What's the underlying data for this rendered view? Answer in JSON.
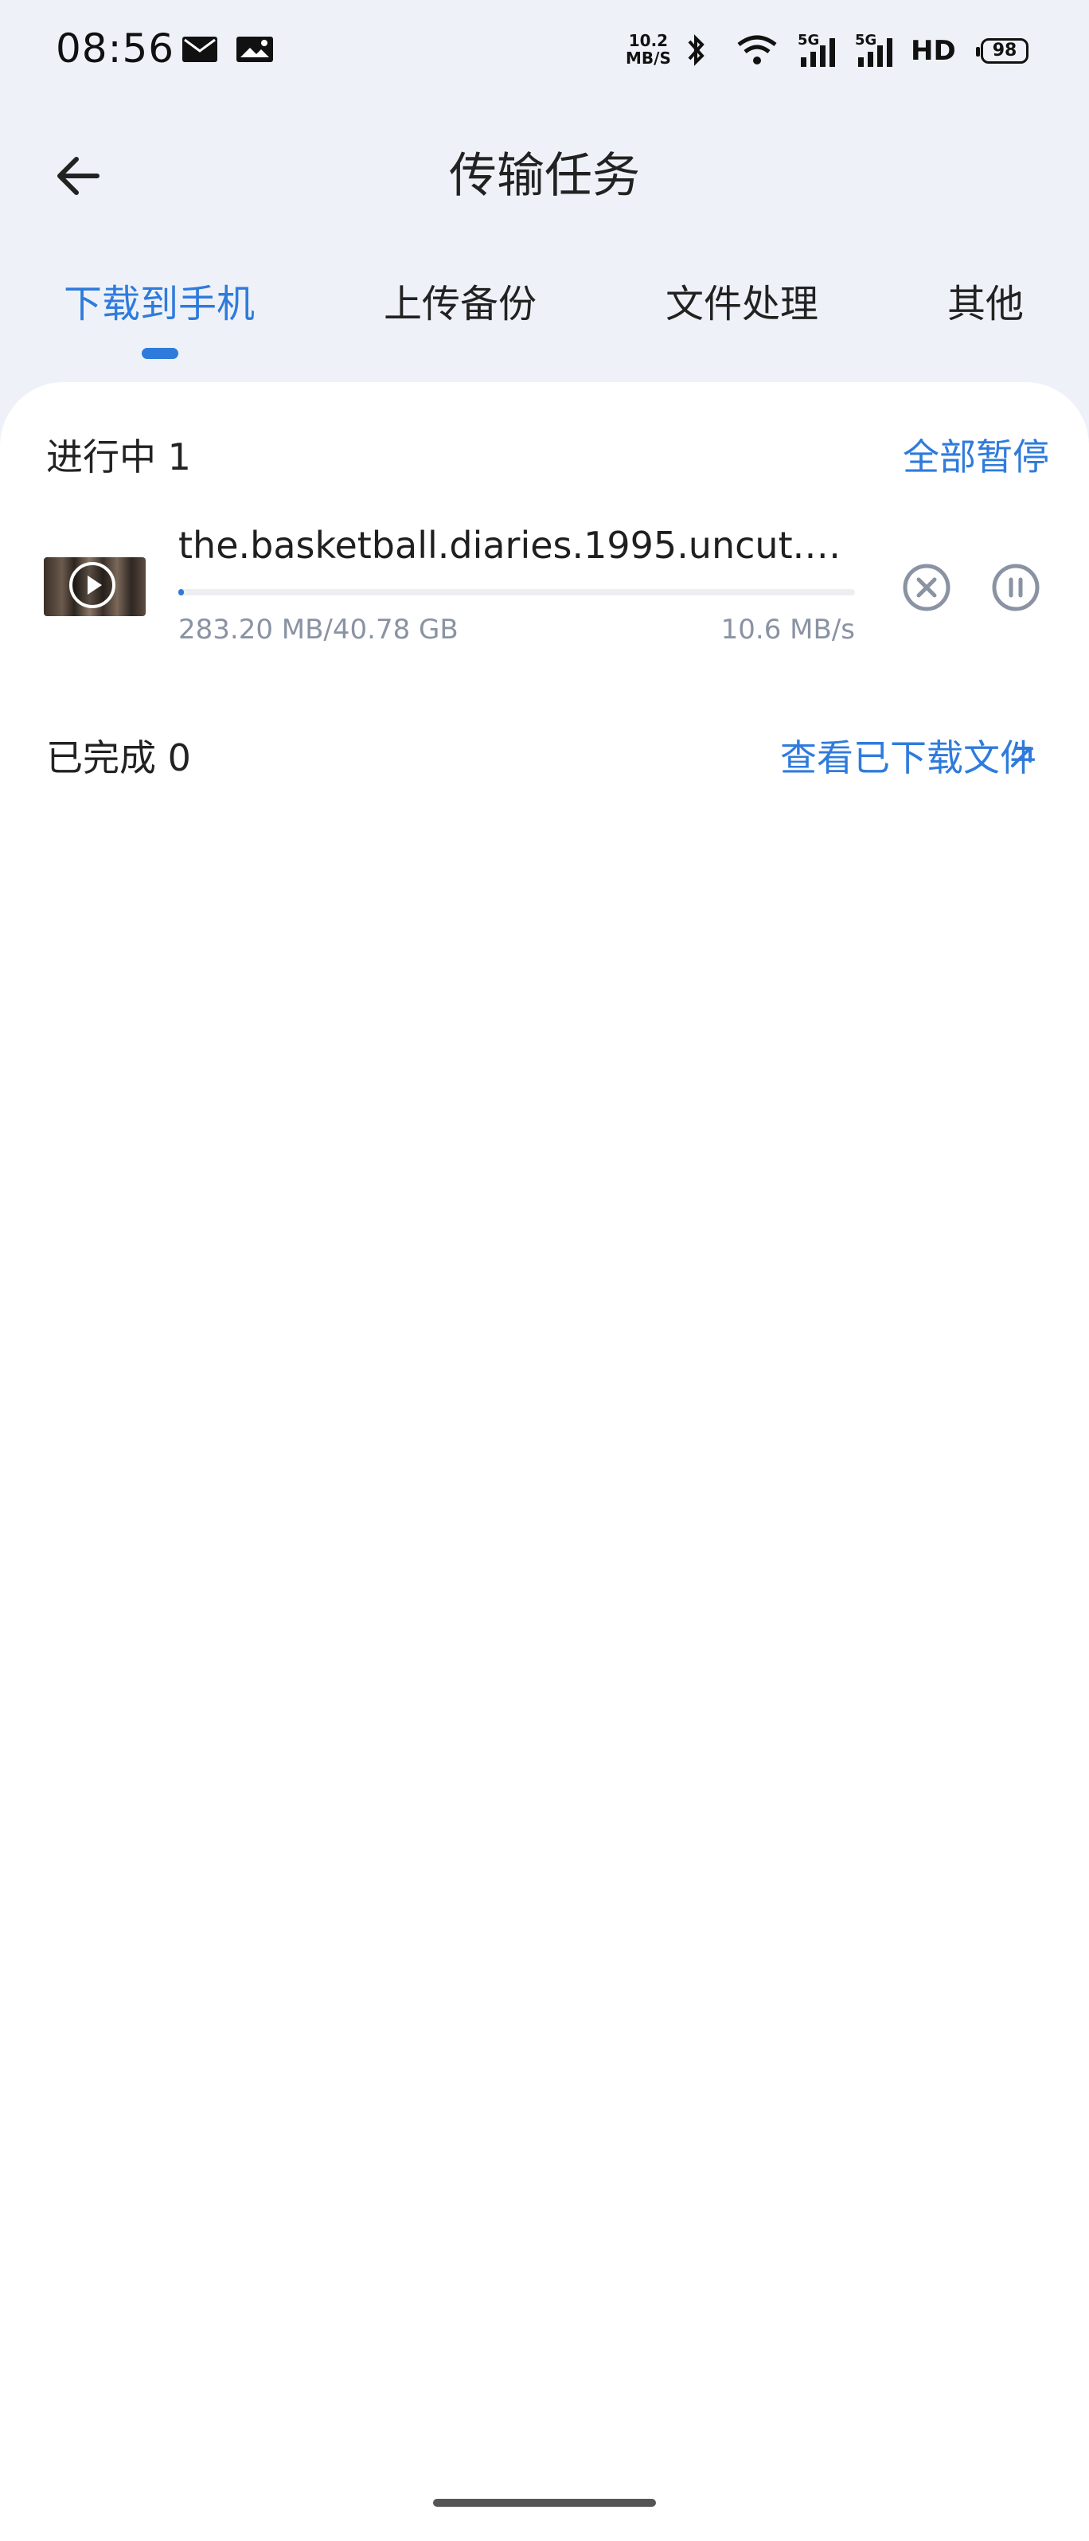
{
  "status_bar": {
    "time": "08:56",
    "net_speed_top": "10.2",
    "net_speed_bottom": "MB/S",
    "signal1": "5G",
    "signal2": "5G",
    "hd": "HD",
    "battery": "98",
    "icons": [
      "mail-icon",
      "image-message-icon",
      "bluetooth-icon",
      "wifi-icon",
      "signal-icon",
      "signal-icon"
    ]
  },
  "header": {
    "title": "传输任务",
    "back_icon": "arrow-left-icon"
  },
  "tabs": [
    {
      "label": "下载到手机",
      "active": true
    },
    {
      "label": "上传备份",
      "active": false
    },
    {
      "label": "文件处理",
      "active": false
    },
    {
      "label": "其他",
      "active": false
    }
  ],
  "in_progress": {
    "title": "进行中 1",
    "action": "全部暂停",
    "items": [
      {
        "filename": "the.basketball.diaries.1995.uncut.4…",
        "size": "283.20 MB/40.78 GB",
        "speed": "10.6 MB/s",
        "progress": 0.007,
        "thumb_icon": "play-icon",
        "cancel_icon": "cancel-circle-icon",
        "pause_icon": "pause-circle-icon"
      }
    ]
  },
  "completed": {
    "title": "已完成 0",
    "action": "查看已下载文件",
    "action_icon": "arrow-up-right-icon"
  },
  "colors": {
    "accent": "#2f7bdc",
    "background": "#eef2f8",
    "card": "#ffffff",
    "muted_text": "#8a93a3"
  }
}
